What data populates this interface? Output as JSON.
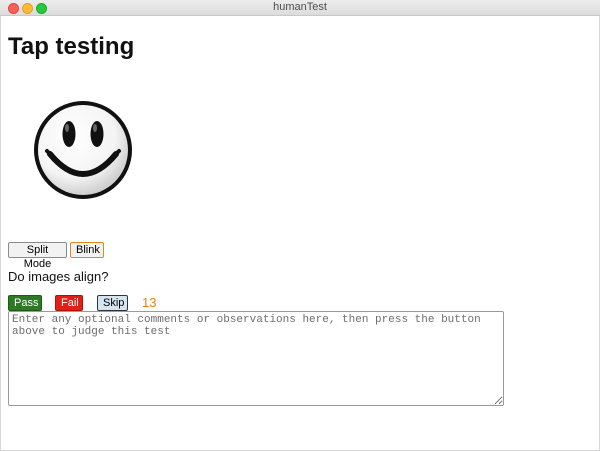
{
  "window": {
    "title": "humanTest"
  },
  "page": {
    "title": "Tap testing"
  },
  "image": {
    "icon": "smiley-face-icon"
  },
  "controls": {
    "split_mode_label": "Split Mode",
    "blink_label": "Blink"
  },
  "question": "Do images align?",
  "verdict": {
    "pass_label": "Pass",
    "fail_label": "Fail",
    "skip_label": "Skip",
    "counter": "13"
  },
  "comments": {
    "placeholder": "Enter any optional comments or observations here, then press the button above to judge this test",
    "value": ""
  },
  "colors": {
    "pass": "#2c7a24",
    "fail": "#e31f13",
    "skip": "#d5e5f0",
    "counter": "#e8820c",
    "blink_border": "#e08a1a"
  }
}
